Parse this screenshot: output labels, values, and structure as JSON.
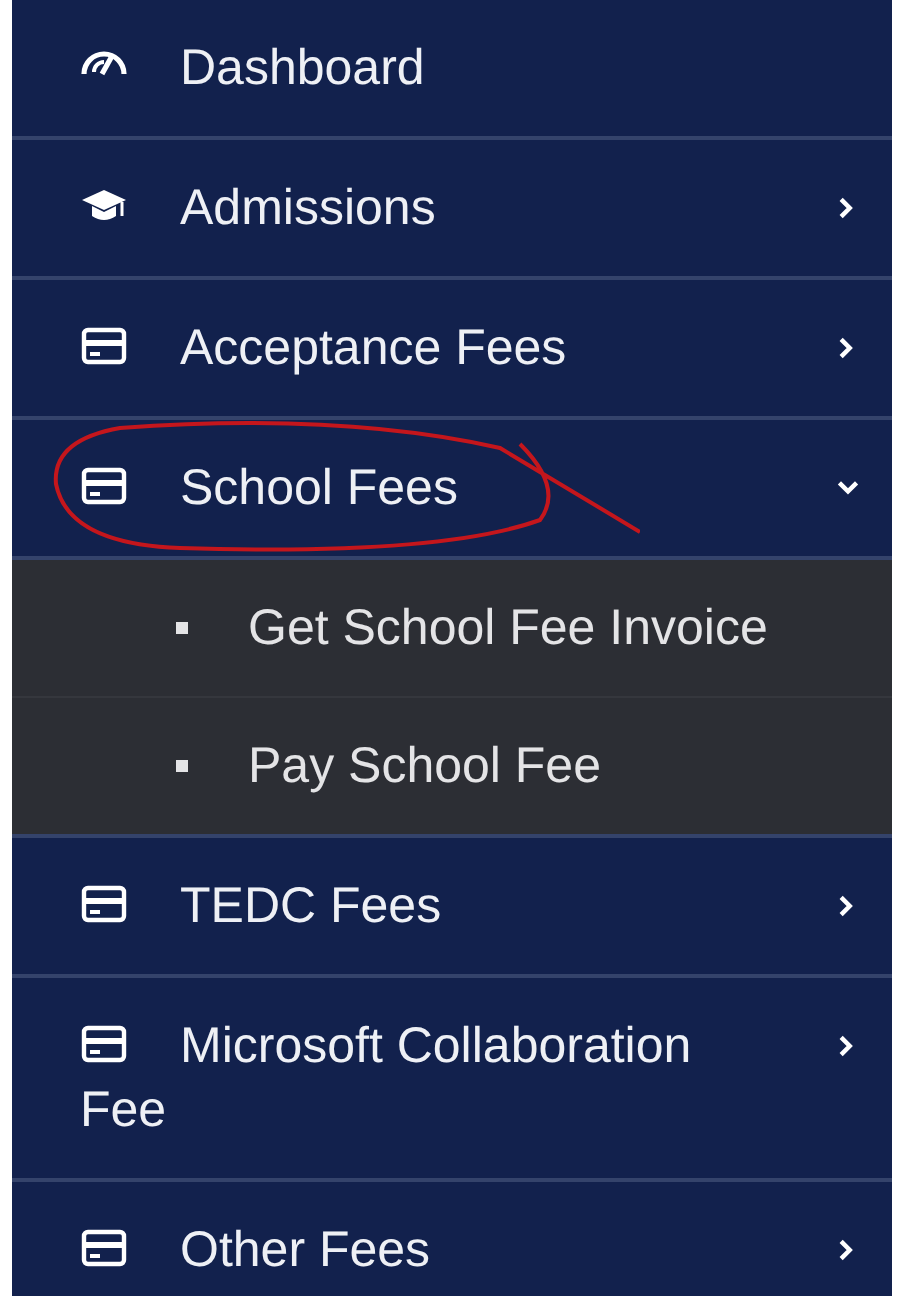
{
  "sidebar": {
    "items": [
      {
        "label": "Dashboard",
        "kind": "dashboard",
        "annotated": false
      },
      {
        "label": "Admissions",
        "kind": "academic",
        "expanded": false,
        "annotated": false
      },
      {
        "label": "Acceptance Fees",
        "kind": "payment",
        "expanded": false,
        "annotated": false
      },
      {
        "label": "School Fees",
        "kind": "payment",
        "expanded": true,
        "annotated": true,
        "children": [
          {
            "label": "Get School Fee Invoice"
          },
          {
            "label": "Pay School Fee"
          }
        ]
      },
      {
        "label": "TEDC Fees",
        "kind": "payment",
        "expanded": false,
        "annotated": false
      },
      {
        "label": "Microsoft Collaboration Fee",
        "kind": "payment",
        "expanded": false,
        "annotated": false
      },
      {
        "label": "Other Fees",
        "kind": "payment",
        "expanded": false,
        "annotated": false
      }
    ]
  }
}
